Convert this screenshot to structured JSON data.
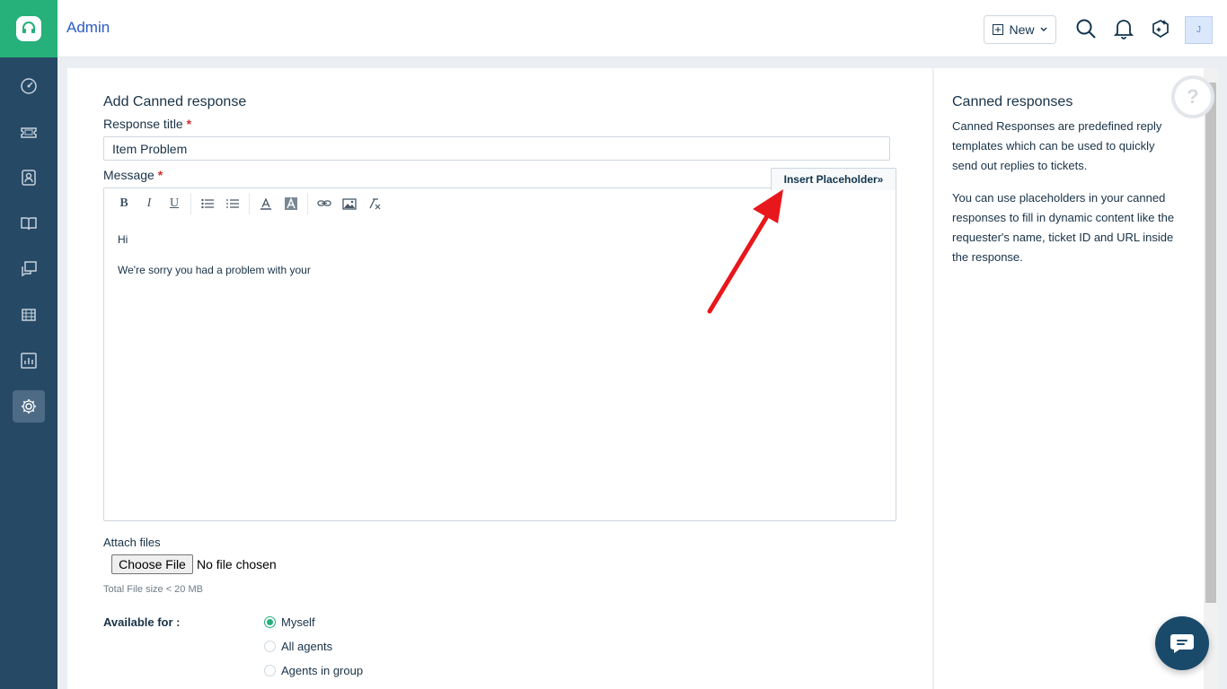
{
  "header": {
    "title": "Admin",
    "new_label": "New",
    "avatar_initial": "J"
  },
  "sidebar": {
    "items": [
      {
        "icon": "dashboard-icon"
      },
      {
        "icon": "ticket-icon"
      },
      {
        "icon": "contacts-icon"
      },
      {
        "icon": "solutions-icon"
      },
      {
        "icon": "forums-icon"
      },
      {
        "icon": "assets-icon"
      },
      {
        "icon": "reports-icon"
      },
      {
        "icon": "admin-gear-icon",
        "active": true
      }
    ]
  },
  "form": {
    "title": "Add Canned response",
    "response_title_label": "Response title",
    "required_mark": "*",
    "response_title_value": "Item Problem",
    "message_label": "Message",
    "insert_placeholder_label": "Insert Placeholder»",
    "toolbar": {
      "bold": "B",
      "italic": "I",
      "underline": "U"
    },
    "message_lines": [
      "Hi",
      "We're sorry you had a problem with your"
    ],
    "attach_label": "Attach files",
    "choose_file_label": "Choose File",
    "no_file_label": "No file chosen",
    "size_note": "Total File size < 20 MB",
    "available_for_label": "Available for :",
    "available_options": [
      {
        "label": "Myself",
        "checked": true
      },
      {
        "label": "All agents",
        "checked": false
      },
      {
        "label": "Agents in group",
        "checked": false
      }
    ]
  },
  "help_panel": {
    "title": "Canned responses",
    "paragraph1": "Canned Responses are predefined reply templates which can be used to quickly send out replies to tickets.",
    "paragraph2": "You can use placeholders in your canned responses to fill in dynamic content like the requester's name, ticket ID and URL inside the response.",
    "help_glyph": "?"
  },
  "colors": {
    "sidebar_bg": "#264966",
    "brand_green": "#26b07a",
    "link_blue": "#2c5cc5",
    "required_red": "#d72d30",
    "annotation_arrow": "#e8171b"
  }
}
